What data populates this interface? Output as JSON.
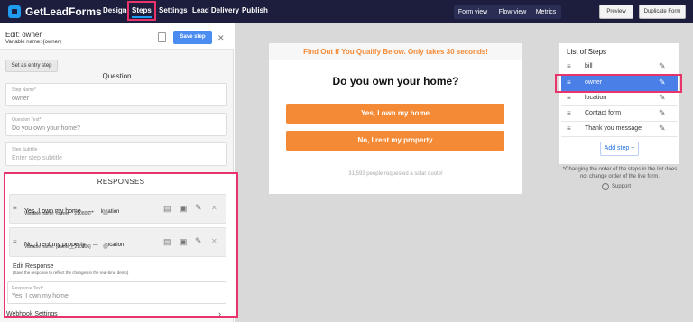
{
  "nav": {
    "logo": "GetLeadForms",
    "items": [
      "Design",
      "Steps",
      "Settings",
      "Lead Delivery",
      "Publish"
    ],
    "views": [
      "Form view",
      "Flow view",
      "Metrics"
    ],
    "preview": "Preview",
    "duplicate": "Duplicate Form"
  },
  "editor": {
    "title": "Edit: owner",
    "variable_label": "Variable name:",
    "variable_value": "{owner}",
    "save": "Save step",
    "entry_step": "Set as entry step",
    "section_title": "Question",
    "step_name_label": "Step Name*",
    "step_name_value": "owner",
    "question_label": "Question Text*",
    "question_value": "Do you own your home?",
    "subtitle_label": "Step Subtitle",
    "subtitle_placeholder": "Enter step subtitle"
  },
  "responses": {
    "title": "RESPONSES",
    "items": [
      {
        "label": "Yes, I own my home",
        "arrow": "→",
        "target": "location",
        "var_label": "Variable name: {owner__210805}"
      },
      {
        "label": "No, I rent my property",
        "arrow": "→",
        "target": "location",
        "var_label": "Variable name: {owner__210806}"
      }
    ],
    "edit_title": "Edit Response",
    "edit_note": "(Save the response to reflect the changes in the real-time demo)",
    "text_label": "Response Text*",
    "text_value": "Yes, I own my home",
    "webhook": "Webhook Settings"
  },
  "preview": {
    "banner": "Find Out If You Qualify Below. Only takes 30 seconds!",
    "question": "Do you own your home?",
    "buttons": [
      "Yes, I own my home",
      "No, I rent my property"
    ],
    "social_proof": "31,593 people requested a solar quote!"
  },
  "steps": {
    "title": "List of Steps",
    "items": [
      "bill",
      "owner",
      "location",
      "Contact form",
      "Thank you message"
    ],
    "add": "Add step +",
    "note": "*Changing the order of the steps in the list does not change order of the live form.",
    "support": "Support"
  },
  "colors": {
    "nav_bg": "#1d1d3d",
    "accent": "#1f9cf0",
    "orange": "#f58a36",
    "highlight": "#e8346b",
    "selected_step": "#4a7fe8"
  }
}
